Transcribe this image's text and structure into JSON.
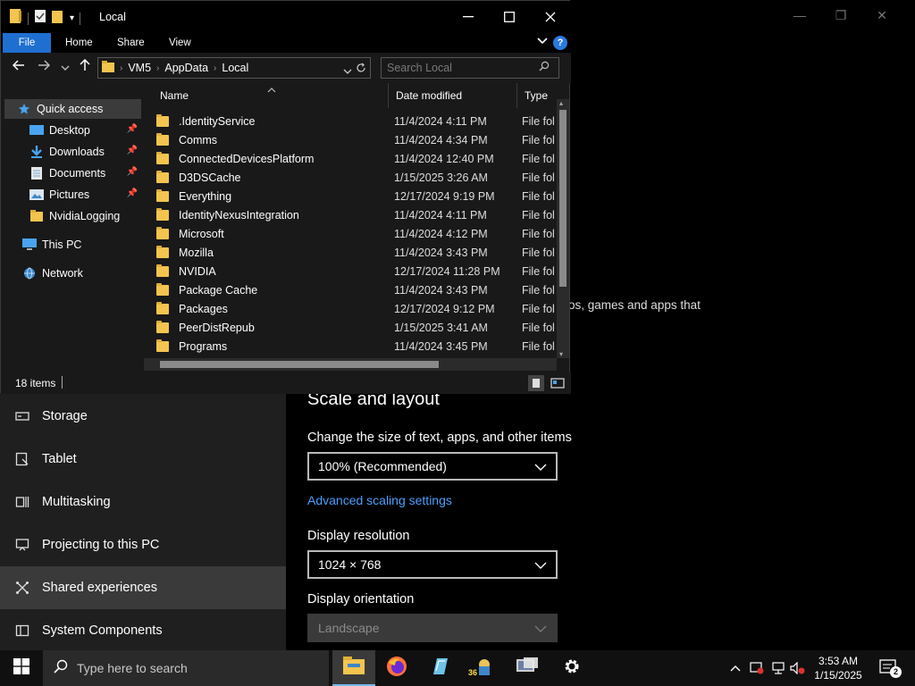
{
  "explorer": {
    "title": "Local",
    "ribbon_tabs": [
      "File",
      "Home",
      "Share",
      "View"
    ],
    "breadcrumb": [
      "VM5",
      "AppData",
      "Local"
    ],
    "search_placeholder": "Search Local",
    "columns": [
      "Name",
      "Date modified",
      "Type"
    ],
    "nav": {
      "quick_access": "Quick access",
      "desktop": "Desktop",
      "downloads": "Downloads",
      "documents": "Documents",
      "pictures": "Pictures",
      "nvidialogging": "NvidiaLogging",
      "this_pc": "This PC",
      "network": "Network"
    },
    "files": [
      {
        "name": ".IdentityService",
        "date": "11/4/2024 4:11 PM",
        "type": "File folder"
      },
      {
        "name": "Comms",
        "date": "11/4/2024 4:34 PM",
        "type": "File folder"
      },
      {
        "name": "ConnectedDevicesPlatform",
        "date": "11/4/2024 12:40 PM",
        "type": "File folder"
      },
      {
        "name": "D3DSCache",
        "date": "1/15/2025 3:26 AM",
        "type": "File folder"
      },
      {
        "name": "Everything",
        "date": "12/17/2024 9:19 PM",
        "type": "File folder"
      },
      {
        "name": "IdentityNexusIntegration",
        "date": "11/4/2024 4:11 PM",
        "type": "File folder"
      },
      {
        "name": "Microsoft",
        "date": "11/4/2024 4:12 PM",
        "type": "File folder"
      },
      {
        "name": "Mozilla",
        "date": "11/4/2024 3:43 PM",
        "type": "File folder"
      },
      {
        "name": "NVIDIA",
        "date": "12/17/2024 11:28 PM",
        "type": "File folder"
      },
      {
        "name": "Package Cache",
        "date": "11/4/2024 3:43 PM",
        "type": "File folder"
      },
      {
        "name": "Packages",
        "date": "12/17/2024 9:12 PM",
        "type": "File folder"
      },
      {
        "name": "PeerDistRepub",
        "date": "1/15/2025 3:41 AM",
        "type": "File folder"
      },
      {
        "name": "Programs",
        "date": "11/4/2024 3:45 PM",
        "type": "File folder"
      }
    ],
    "status": "18 items"
  },
  "settings": {
    "nav_items": [
      "Storage",
      "Tablet",
      "Multitasking",
      "Projecting to this PC",
      "Shared experiences",
      "System Components"
    ],
    "apps_text": "os, games and apps that",
    "scale_heading": "Scale and layout",
    "scale_label": "Change the size of text, apps, and other items",
    "scale_value": "100% (Recommended)",
    "advanced_link": "Advanced scaling settings",
    "resolution_label": "Display resolution",
    "resolution_value": "1024 × 768",
    "orientation_label": "Display orientation",
    "orientation_value": "Landscape"
  },
  "taskbar": {
    "search_placeholder": "Type here to search",
    "time": "3:53 AM",
    "date": "1/15/2025",
    "notification_count": "2",
    "app_badge": "36"
  }
}
